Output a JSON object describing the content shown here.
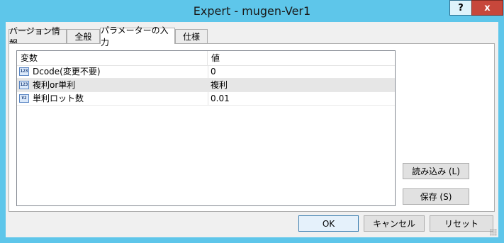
{
  "window": {
    "title": "Expert - mugen-Ver1",
    "help_label": "?",
    "close_label": "x"
  },
  "tabs": [
    {
      "label": "バージョン情報"
    },
    {
      "label": "全般"
    },
    {
      "label": "パラメーターの入力",
      "active": true
    },
    {
      "label": "仕様"
    }
  ],
  "grid": {
    "columns": [
      "変数",
      "値"
    ],
    "rows": [
      {
        "icon": "123",
        "icon_name": "integer-icon",
        "name": "Dcode(変更不要)",
        "value": "0"
      },
      {
        "icon": "123",
        "icon_name": "integer-icon",
        "name": "複利or単利",
        "value": "複利"
      },
      {
        "icon": "V2",
        "icon_name": "double-icon",
        "name": "単利ロット数",
        "value": "0.01"
      }
    ],
    "selected_row": 1
  },
  "side_buttons": {
    "load": "読み込み (L)",
    "save": "保存 (S)"
  },
  "bottom_buttons": {
    "ok": "OK",
    "cancel": "キャンセル",
    "reset": "リセット"
  },
  "colors": {
    "titlebar": "#5ec6ea",
    "close": "#c7473b",
    "selected_row": "#e6e6e6"
  }
}
